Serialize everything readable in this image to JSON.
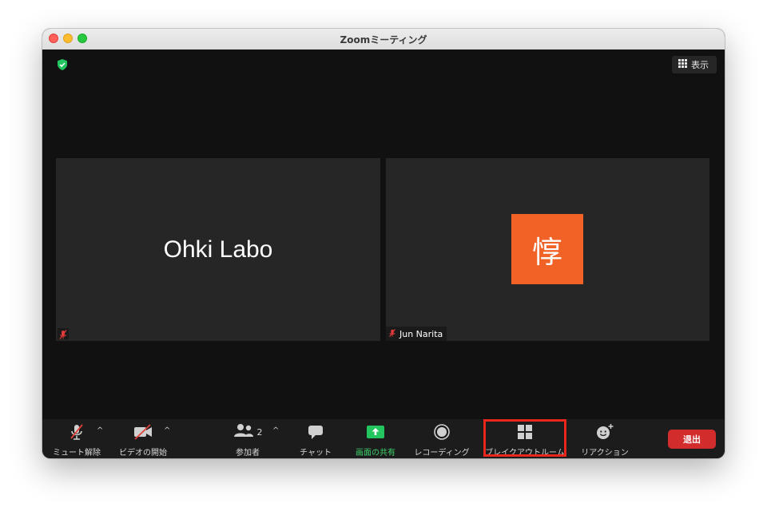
{
  "window": {
    "title": "Zoomミーティング"
  },
  "top_bar": {
    "view_label": "表示",
    "shield_icon": "shield-check-icon",
    "shield_color": "#22c55e"
  },
  "tiles": [
    {
      "display_name": "Ohki Labo",
      "muted": true
    },
    {
      "avatar_char": "惇",
      "name_tag": "Jun Narita",
      "muted": true,
      "avatar_color": "#f06225"
    }
  ],
  "toolbar": {
    "mute_label": "ミュート解除",
    "video_label": "ビデオの開始",
    "participants_label": "参加者",
    "participants_count": "2",
    "chat_label": "チャット",
    "share_label": "画面の共有",
    "record_label": "レコーディング",
    "breakout_label": "ブレイクアウトルーム",
    "reactions_label": "リアクション",
    "end_label": "退出",
    "share_color": "#22c55e",
    "end_color": "#d22c2c",
    "highlight_color": "#e8261b"
  }
}
